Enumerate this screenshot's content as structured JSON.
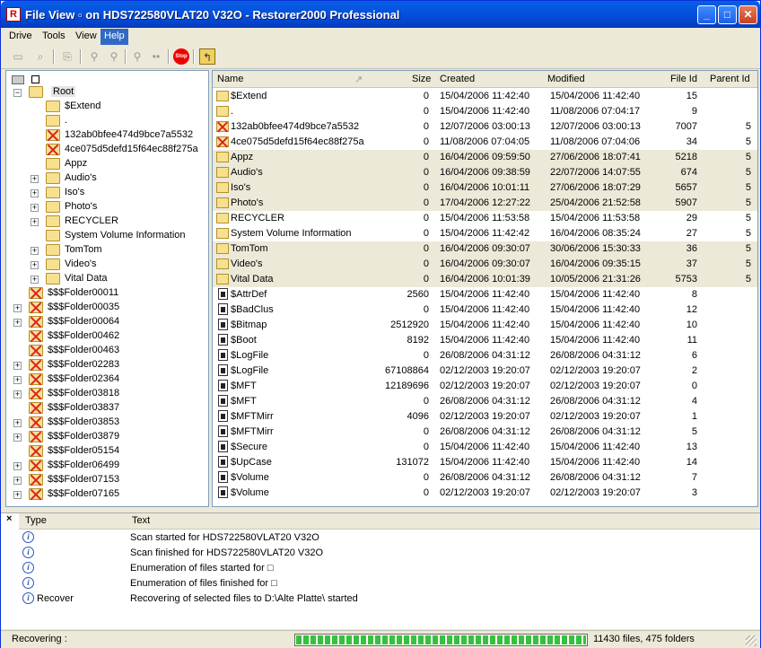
{
  "window": {
    "title": "File View ▫ on HDS722580VLAT20 V32O - Restorer2000 Professional",
    "app_icon": "restorer-app-icon",
    "controls": {
      "minimize": "_",
      "maximize": "□",
      "close": "✕"
    }
  },
  "menu": [
    {
      "label": "Drive"
    },
    {
      "label": "Tools"
    },
    {
      "label": "View"
    },
    {
      "label": "Help",
      "active": true
    }
  ],
  "toolbar": {
    "icons": [
      "drive-icon",
      "scan-icon",
      "recover-icon",
      "find-icon",
      "find-next-icon",
      "filter-icon",
      "dots-icon",
      "stop-icon",
      "up-folder-icon"
    ],
    "stop_text": "Stop"
  },
  "tree": {
    "root_label": "Root",
    "nodes": [
      {
        "label": "$Extend",
        "type": "folder",
        "level": 2,
        "expander": false
      },
      {
        "label": ".",
        "type": "folder",
        "level": 2,
        "expander": false
      },
      {
        "label": "132ab0bfee474d9bce7a5532",
        "type": "deleted",
        "level": 2,
        "expander": false
      },
      {
        "label": "4ce075d5defd15f64ec88f275a",
        "type": "deleted",
        "level": 2,
        "expander": false
      },
      {
        "label": "Appz",
        "type": "folder",
        "level": 2,
        "expander": false
      },
      {
        "label": "Audio's",
        "type": "folder",
        "level": 2,
        "expander": true
      },
      {
        "label": "Iso's",
        "type": "folder",
        "level": 2,
        "expander": true
      },
      {
        "label": "Photo's",
        "type": "folder",
        "level": 2,
        "expander": true
      },
      {
        "label": "RECYCLER",
        "type": "folder",
        "level": 2,
        "expander": true
      },
      {
        "label": "System Volume Information",
        "type": "folder",
        "level": 2,
        "expander": false
      },
      {
        "label": "TomTom",
        "type": "folder",
        "level": 2,
        "expander": true
      },
      {
        "label": "Video's",
        "type": "folder",
        "level": 2,
        "expander": true
      },
      {
        "label": "Vital Data",
        "type": "folder",
        "level": 2,
        "expander": true
      },
      {
        "label": "$$$Folder00011",
        "type": "deleted",
        "level": 1,
        "expander": false
      },
      {
        "label": "$$$Folder00035",
        "type": "deleted",
        "level": 1,
        "expander": true
      },
      {
        "label": "$$$Folder00064",
        "type": "deleted",
        "level": 1,
        "expander": true
      },
      {
        "label": "$$$Folder00462",
        "type": "deleted",
        "level": 1,
        "expander": false
      },
      {
        "label": "$$$Folder00463",
        "type": "deleted",
        "level": 1,
        "expander": false
      },
      {
        "label": "$$$Folder02283",
        "type": "deleted",
        "level": 1,
        "expander": true
      },
      {
        "label": "$$$Folder02364",
        "type": "deleted",
        "level": 1,
        "expander": true
      },
      {
        "label": "$$$Folder03818",
        "type": "deleted",
        "level": 1,
        "expander": true
      },
      {
        "label": "$$$Folder03837",
        "type": "deleted",
        "level": 1,
        "expander": false
      },
      {
        "label": "$$$Folder03853",
        "type": "deleted",
        "level": 1,
        "expander": true
      },
      {
        "label": "$$$Folder03879",
        "type": "deleted",
        "level": 1,
        "expander": true
      },
      {
        "label": "$$$Folder05154",
        "type": "deleted",
        "level": 1,
        "expander": false
      },
      {
        "label": "$$$Folder06499",
        "type": "deleted",
        "level": 1,
        "expander": true
      },
      {
        "label": "$$$Folder07153",
        "type": "deleted",
        "level": 1,
        "expander": true
      },
      {
        "label": "$$$Folder07165",
        "type": "deleted",
        "level": 1,
        "expander": true
      }
    ]
  },
  "list": {
    "columns": [
      "Name",
      "Size",
      "Created",
      "Modified",
      "File Id",
      "Parent Id"
    ],
    "rows": [
      {
        "name": "$Extend",
        "type": "folder",
        "size": "0",
        "created": "15/04/2006 11:42:40",
        "modified": "15/04/2006 11:42:40",
        "file_id": "15",
        "parent_id": "",
        "hl": false
      },
      {
        "name": ".",
        "type": "folder",
        "size": "0",
        "created": "15/04/2006 11:42:40",
        "modified": "11/08/2006 07:04:17",
        "file_id": "9",
        "parent_id": "",
        "hl": false
      },
      {
        "name": "132ab0bfee474d9bce7a5532",
        "type": "deleted",
        "size": "0",
        "created": "12/07/2006 03:00:13",
        "modified": "12/07/2006 03:00:13",
        "file_id": "7007",
        "parent_id": "5",
        "hl": false
      },
      {
        "name": "4ce075d5defd15f64ec88f275a",
        "type": "deleted",
        "size": "0",
        "created": "11/08/2006 07:04:05",
        "modified": "11/08/2006 07:04:06",
        "file_id": "34",
        "parent_id": "5",
        "hl": false
      },
      {
        "name": "Appz",
        "type": "folder",
        "size": "0",
        "created": "16/04/2006 09:59:50",
        "modified": "27/06/2006 18:07:41",
        "file_id": "5218",
        "parent_id": "5",
        "hl": true
      },
      {
        "name": "Audio's",
        "type": "folder",
        "size": "0",
        "created": "16/04/2006 09:38:59",
        "modified": "22/07/2006 14:07:55",
        "file_id": "674",
        "parent_id": "5",
        "hl": true
      },
      {
        "name": "Iso's",
        "type": "folder",
        "size": "0",
        "created": "16/04/2006 10:01:11",
        "modified": "27/06/2006 18:07:29",
        "file_id": "5657",
        "parent_id": "5",
        "hl": true
      },
      {
        "name": "Photo's",
        "type": "folder",
        "size": "0",
        "created": "17/04/2006 12:27:22",
        "modified": "25/04/2006 21:52:58",
        "file_id": "5907",
        "parent_id": "5",
        "hl": true
      },
      {
        "name": "RECYCLER",
        "type": "folder",
        "size": "0",
        "created": "15/04/2006 11:53:58",
        "modified": "15/04/2006 11:53:58",
        "file_id": "29",
        "parent_id": "5",
        "hl": false
      },
      {
        "name": "System Volume Information",
        "type": "folder",
        "size": "0",
        "created": "15/04/2006 11:42:42",
        "modified": "16/04/2006 08:35:24",
        "file_id": "27",
        "parent_id": "5",
        "hl": false
      },
      {
        "name": "TomTom",
        "type": "folder",
        "size": "0",
        "created": "16/04/2006 09:30:07",
        "modified": "30/06/2006 15:30:33",
        "file_id": "36",
        "parent_id": "5",
        "hl": true
      },
      {
        "name": "Video's",
        "type": "folder",
        "size": "0",
        "created": "16/04/2006 09:30:07",
        "modified": "16/04/2006 09:35:15",
        "file_id": "37",
        "parent_id": "5",
        "hl": true
      },
      {
        "name": "Vital Data",
        "type": "folder",
        "size": "0",
        "created": "16/04/2006 10:01:39",
        "modified": "10/05/2006 21:31:26",
        "file_id": "5753",
        "parent_id": "5",
        "hl": true
      },
      {
        "name": "$AttrDef",
        "type": "file",
        "size": "2560",
        "created": "15/04/2006 11:42:40",
        "modified": "15/04/2006 11:42:40",
        "file_id": "8",
        "parent_id": "",
        "hl": false
      },
      {
        "name": "$BadClus",
        "type": "file",
        "size": "0",
        "created": "15/04/2006 11:42:40",
        "modified": "15/04/2006 11:42:40",
        "file_id": "12",
        "parent_id": "",
        "hl": false
      },
      {
        "name": "$Bitmap",
        "type": "file",
        "size": "2512920",
        "created": "15/04/2006 11:42:40",
        "modified": "15/04/2006 11:42:40",
        "file_id": "10",
        "parent_id": "",
        "hl": false
      },
      {
        "name": "$Boot",
        "type": "file",
        "size": "8192",
        "created": "15/04/2006 11:42:40",
        "modified": "15/04/2006 11:42:40",
        "file_id": "11",
        "parent_id": "",
        "hl": false
      },
      {
        "name": "$LogFile",
        "type": "file",
        "size": "0",
        "created": "26/08/2006 04:31:12",
        "modified": "26/08/2006 04:31:12",
        "file_id": "6",
        "parent_id": "",
        "hl": false
      },
      {
        "name": "$LogFile",
        "type": "file",
        "size": "67108864",
        "created": "02/12/2003 19:20:07",
        "modified": "02/12/2003 19:20:07",
        "file_id": "2",
        "parent_id": "",
        "hl": false
      },
      {
        "name": "$MFT",
        "type": "file",
        "size": "12189696",
        "created": "02/12/2003 19:20:07",
        "modified": "02/12/2003 19:20:07",
        "file_id": "0",
        "parent_id": "",
        "hl": false
      },
      {
        "name": "$MFT",
        "type": "file",
        "size": "0",
        "created": "26/08/2006 04:31:12",
        "modified": "26/08/2006 04:31:12",
        "file_id": "4",
        "parent_id": "",
        "hl": false
      },
      {
        "name": "$MFTMirr",
        "type": "file",
        "size": "4096",
        "created": "02/12/2003 19:20:07",
        "modified": "02/12/2003 19:20:07",
        "file_id": "1",
        "parent_id": "",
        "hl": false
      },
      {
        "name": "$MFTMirr",
        "type": "file",
        "size": "0",
        "created": "26/08/2006 04:31:12",
        "modified": "26/08/2006 04:31:12",
        "file_id": "5",
        "parent_id": "",
        "hl": false
      },
      {
        "name": "$Secure",
        "type": "file",
        "size": "0",
        "created": "15/04/2006 11:42:40",
        "modified": "15/04/2006 11:42:40",
        "file_id": "13",
        "parent_id": "",
        "hl": false
      },
      {
        "name": "$UpCase",
        "type": "file",
        "size": "131072",
        "created": "15/04/2006 11:42:40",
        "modified": "15/04/2006 11:42:40",
        "file_id": "14",
        "parent_id": "",
        "hl": false
      },
      {
        "name": "$Volume",
        "type": "file",
        "size": "0",
        "created": "26/08/2006 04:31:12",
        "modified": "26/08/2006 04:31:12",
        "file_id": "7",
        "parent_id": "",
        "hl": false
      },
      {
        "name": "$Volume",
        "type": "file",
        "size": "0",
        "created": "02/12/2003 19:20:07",
        "modified": "02/12/2003 19:20:07",
        "file_id": "3",
        "parent_id": "",
        "hl": false
      }
    ]
  },
  "log": {
    "close_glyph": "×",
    "columns": [
      "Type",
      "Text"
    ],
    "rows": [
      {
        "type": "",
        "text": "Scan started for HDS722580VLAT20 V32O"
      },
      {
        "type": "",
        "text": "Scan finished for HDS722580VLAT20 V32O"
      },
      {
        "type": "",
        "text": "Enumeration of files started for □"
      },
      {
        "type": "",
        "text": "Enumeration of files finished for □"
      },
      {
        "type": "Recover",
        "text": "Recovering of selected files to D:\\Alte Platte\\ started"
      }
    ]
  },
  "status": {
    "label": "Recovering :",
    "progress": 1.0,
    "counts": "11430 files, 475 folders"
  },
  "colors": {
    "titlebar": "#0453e0",
    "highlight_row": "#ece9d8",
    "progress": "#36c13c",
    "menu_active": "#316ac5"
  }
}
